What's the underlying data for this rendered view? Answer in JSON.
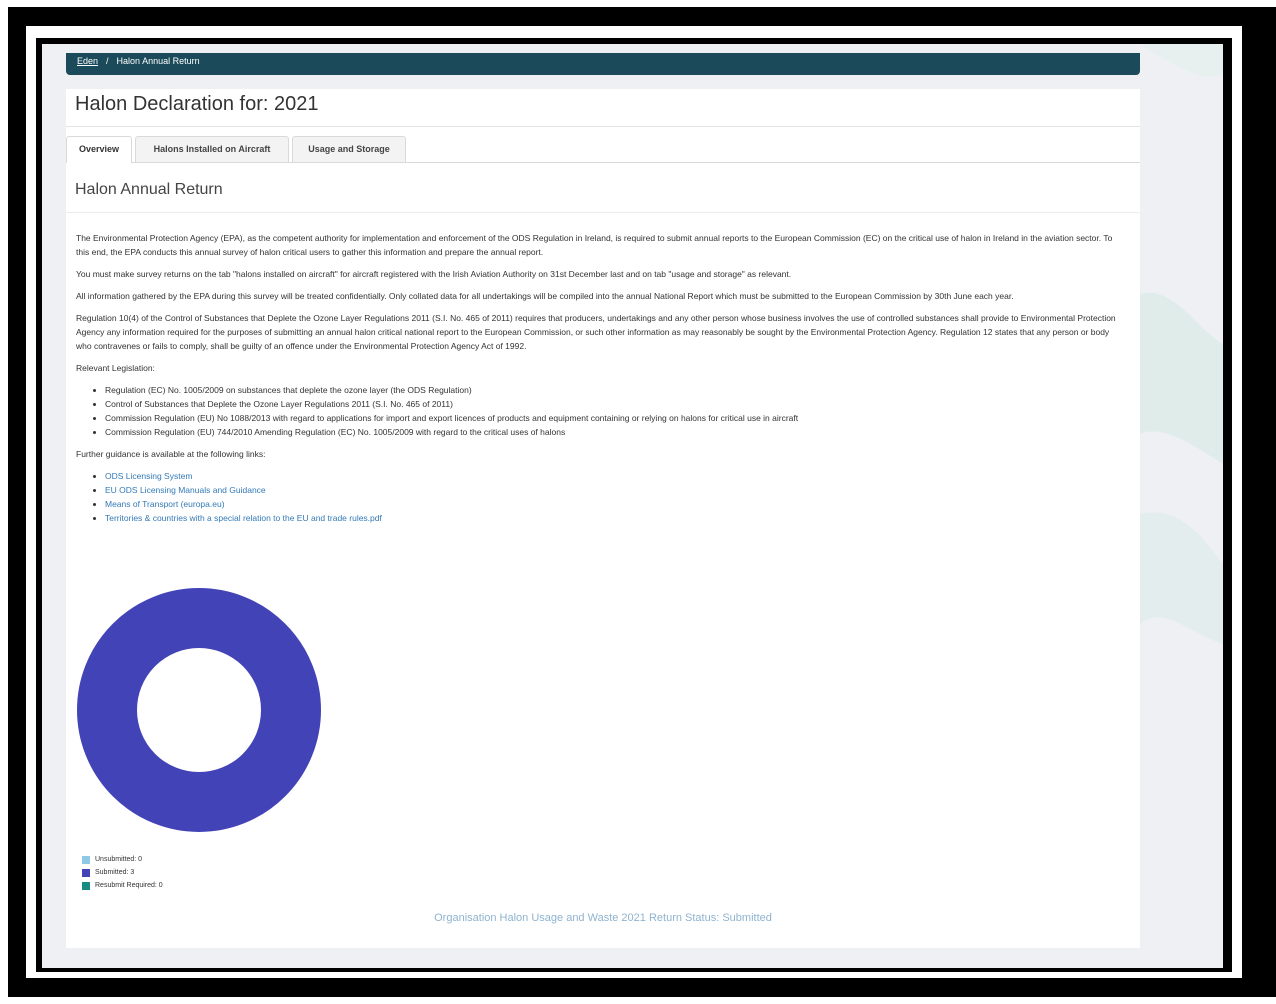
{
  "breadcrumb": {
    "home": "Eden",
    "separator": "/",
    "current": "Halon Annual Return"
  },
  "page_title": "Halon Declaration for: 2021",
  "tabs": [
    {
      "label": "Overview",
      "active": true
    },
    {
      "label": "Halons Installed on Aircraft",
      "active": false
    },
    {
      "label": "Usage and Storage",
      "active": false
    }
  ],
  "section_title": "Halon Annual Return",
  "paragraphs": [
    "The Environmental Protection Agency (EPA), as the competent authority for implementation and enforcement of the ODS Regulation in Ireland, is required to submit annual reports to the European Commission (EC) on the critical use of halon in Ireland in the aviation sector. To this end, the EPA conducts this annual survey of halon critical users to gather this information and prepare the annual report.",
    "You must make survey returns on the tab \"halons installed on aircraft\" for aircraft registered with the Irish Aviation Authority on 31st December last and on tab \"usage and storage\" as relevant.",
    "All information gathered by the EPA during this survey will be treated confidentially. Only collated data for all undertakings will be compiled into the annual National Report which must be submitted to the European Commission by 30th June each year.",
    "Regulation 10(4) of the Control of Substances that Deplete the Ozone Layer Regulations 2011 (S.I. No. 465 of 2011) requires that producers, undertakings and any other person whose business involves the use of controlled substances shall provide to Environmental Protection Agency any information required for the purposes of submitting an annual halon critical national report to the European Commission, or such other information as may reasonably be sought by the Environmental Protection Agency. Regulation 12 states that any person or body who contravenes or fails to comply, shall be guilty of an offence under the Environmental Protection Agency Act of 1992."
  ],
  "legislation_heading": "Relevant Legislation:",
  "legislation": [
    "Regulation (EC) No. 1005/2009 on substances that deplete the ozone layer (the ODS Regulation)",
    "Control of Substances that Deplete the Ozone Layer Regulations 2011 (S.I. No. 465 of 2011)",
    "Commission Regulation (EU) No 1088/2013 with regard to applications for import and export licences of products and equipment containing or relying on halons for critical use in aircraft",
    "Commission Regulation (EU) 744/2010 Amending Regulation (EC) No. 1005/2009 with regard to the critical uses of halons"
  ],
  "guidance_heading": "Further guidance is available at the following links:",
  "guidance_links": [
    "ODS Licensing System",
    "EU ODS Licensing Manuals and Guidance",
    "Means of Transport (europa.eu)",
    "Territories & countries with a special relation to the EU and trade rules.pdf"
  ],
  "chart_data": {
    "type": "pie",
    "donut": true,
    "labels": [
      "Unsubmitted",
      "Submitted",
      "Resubmit Required"
    ],
    "values": [
      0,
      3,
      0
    ],
    "colors": [
      "#8ecae6",
      "#4343b8",
      "#1a8a82"
    ],
    "legend_position": "bottom-left",
    "legend_text": [
      "Unsubmitted: 0",
      "Submitted: 3",
      "Resubmit Required: 0"
    ]
  },
  "status_text": "Organisation Halon Usage and Waste 2021 Return Status: Submitted"
}
